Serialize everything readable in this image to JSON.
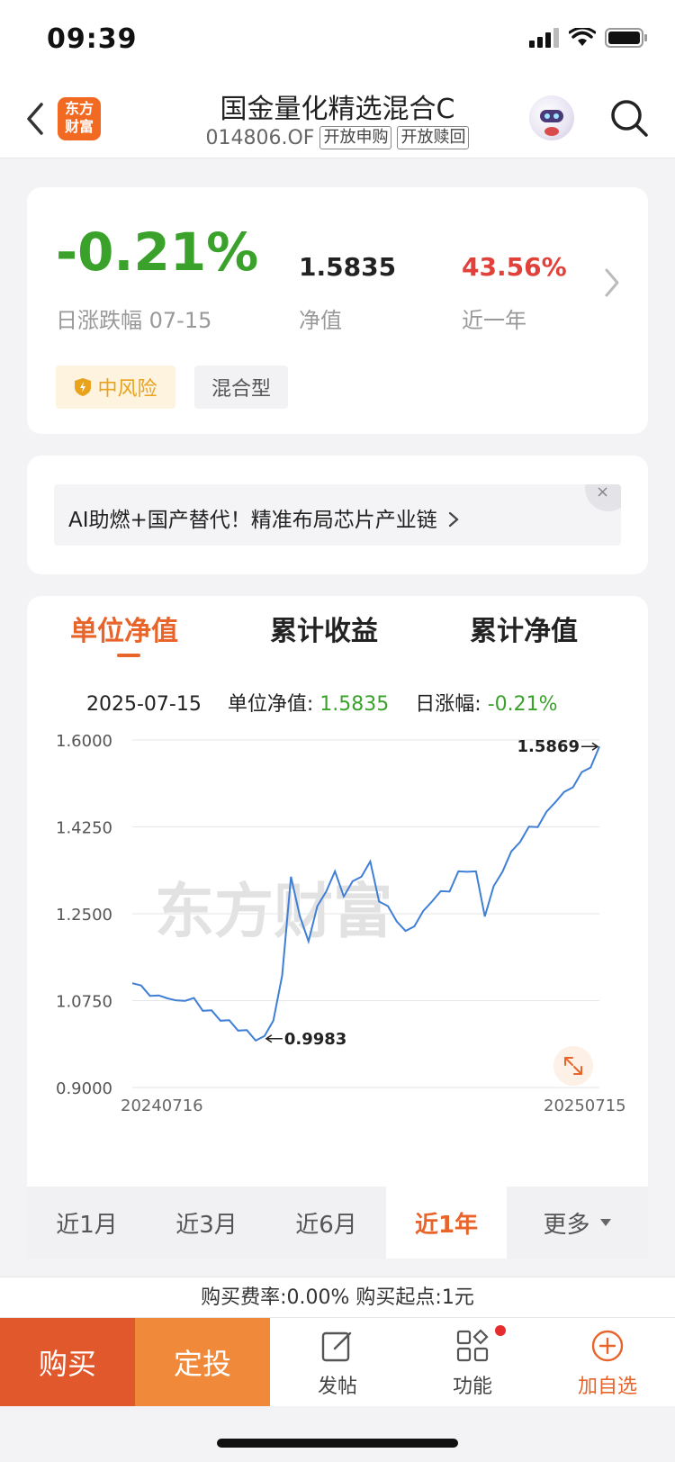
{
  "status": {
    "time": "09:39"
  },
  "header": {
    "logo_line1": "东方",
    "logo_line2": "财富",
    "title": "国金量化精选混合C",
    "code": "014806.OF",
    "tag_buy": "开放申购",
    "tag_redeem": "开放赎回"
  },
  "summary": {
    "daily_change": "-0.21%",
    "daily_change_label": "日涨跌幅 07-15",
    "nav": "1.5835",
    "nav_label": "净值",
    "one_year": "43.56%",
    "one_year_label": "近一年",
    "risk_label": "中风险",
    "type_label": "混合型"
  },
  "banner": {
    "text": "AI助燃+国产替代！精准布局芯片产业链",
    "close": "×"
  },
  "chart_tabs": [
    "单位净值",
    "累计收益",
    "累计净值"
  ],
  "info_row": {
    "date": "2025-07-15",
    "nav_label": "单位净值:",
    "nav_value": "1.5835",
    "change_label": "日涨幅:",
    "change_value": "-0.21%"
  },
  "chart_data": {
    "type": "line",
    "watermark": "东方财富",
    "ytick_labels": [
      "1.6000",
      "1.4250",
      "1.2500",
      "1.0750",
      "0.9000"
    ],
    "ylim": [
      0.9,
      1.6
    ],
    "x_start_label": "20240716",
    "x_end_label": "20250715",
    "annotation_max": "1.5869",
    "annotation_min": "0.9983",
    "series": [
      {
        "color": "#3f7fd6",
        "values": [
          1.11,
          1.1,
          1.09,
          1.08,
          1.085,
          1.07,
          1.08,
          1.075,
          1.06,
          1.05,
          1.04,
          1.03,
          1.02,
          1.01,
          1.0,
          0.9983,
          1.04,
          1.12,
          1.33,
          1.24,
          1.2,
          1.26,
          1.3,
          1.33,
          1.29,
          1.31,
          1.33,
          1.35,
          1.28,
          1.26,
          1.24,
          1.21,
          1.23,
          1.25,
          1.28,
          1.29,
          1.3,
          1.33,
          1.34,
          1.33,
          1.25,
          1.3,
          1.34,
          1.37,
          1.4,
          1.42,
          1.43,
          1.45,
          1.48,
          1.49,
          1.51,
          1.53,
          1.55,
          1.5869
        ]
      }
    ]
  },
  "ranges": [
    "近1月",
    "近3月",
    "近6月",
    "近1年",
    "更多"
  ],
  "fee": "购买费率:0.00%   购买起点:1元",
  "bottom": {
    "buy": "购买",
    "plan": "定投",
    "post": "发帖",
    "func": "功能",
    "watch": "加自选"
  }
}
